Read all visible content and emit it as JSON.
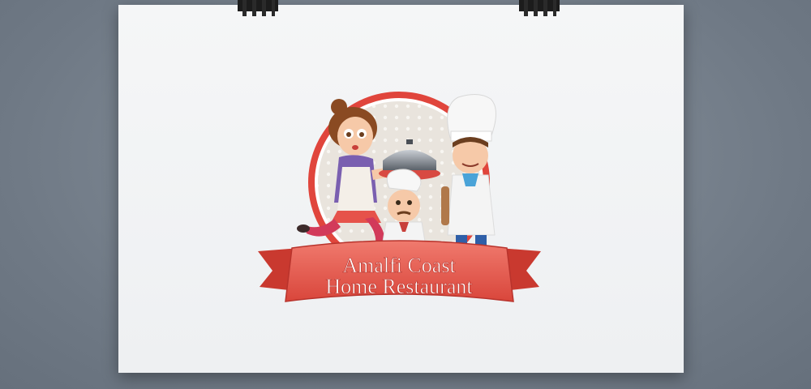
{
  "logo": {
    "line1": "Amalfi Coast",
    "line2": "Home Restaurant"
  },
  "colors": {
    "ring": "#e0453c",
    "ribbon": "#e85a4f",
    "ribbon_dark": "#b8332c",
    "badge_bg": "#ebe6df",
    "clip": "#1a1a1a"
  },
  "icons": [
    "binder-clip-icon",
    "waitress-illustration",
    "chef-illustration",
    "cook-illustration",
    "serving-pot-icon"
  ]
}
